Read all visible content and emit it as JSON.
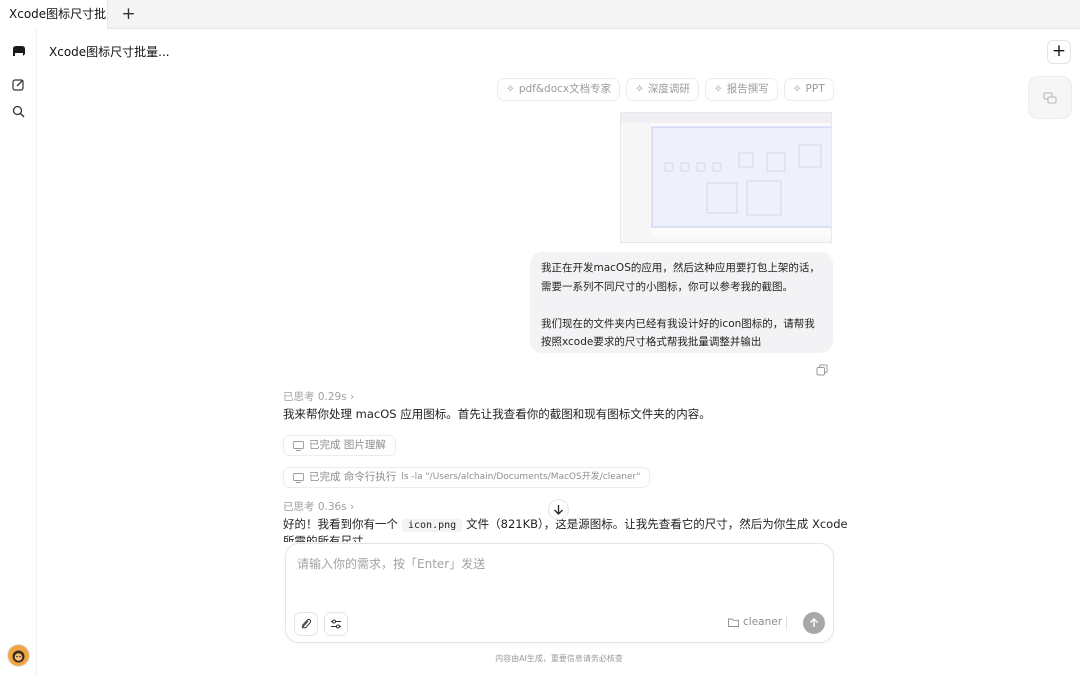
{
  "tabbar": {
    "active_tab": "Xcode图标尺寸批...",
    "add_tab_icon": "plus-icon"
  },
  "rail": {
    "icons": [
      "logo-icon",
      "edit-icon",
      "search-icon",
      "avatar"
    ]
  },
  "header": {
    "conversation_title": "Xcode图标尺寸批量...",
    "new_chat_icon": "plus-icon"
  },
  "skills": [
    {
      "label": "pdf&docx文档专家",
      "icon": "sparkle-icon"
    },
    {
      "label": "深度调研",
      "icon": "sparkle-icon"
    },
    {
      "label": "报告撰写",
      "icon": "sparkle-icon"
    },
    {
      "label": "PPT",
      "icon": "sparkle-icon"
    }
  ],
  "user_message": {
    "line1": "我正在开发macOS的应用，然后这种应用要打包上架的话，需要一系列不同尺寸的小图标，你可以参考我的截图。",
    "line2": "我们现在的文件夹内已经有我设计好的icon图标的，请帮我按照xcode要求的尺寸格式帮我批量调整并输出"
  },
  "assistant": {
    "think1": "已思考 0.29s ›",
    "reply1": "我来帮你处理 macOS 应用图标。首先让我查看你的截图和现有图标文件夹的内容。",
    "status1": "已完成 图片理解",
    "status2_label": "已完成 命令行执行",
    "status2_cmd": "ls -la \"/Users/alchain/Documents/MacOS开发/cleaner\"",
    "think2": "已思考 0.36s ›",
    "reply2_pre": "好的！我看到你有一个",
    "reply2_code": "icon.png",
    "reply2_post": "文件（821KB），这是源图标。让我先查看它的尺寸，然后为你生成 Xcode",
    "reply2_line2": "所需的所有尺寸"
  },
  "composer": {
    "placeholder": "请输入你的需求，按「Enter」发送",
    "folder": "cleaner"
  },
  "footer": {
    "disclaimer": "内容由AI生成，重要信息请务必核查"
  }
}
